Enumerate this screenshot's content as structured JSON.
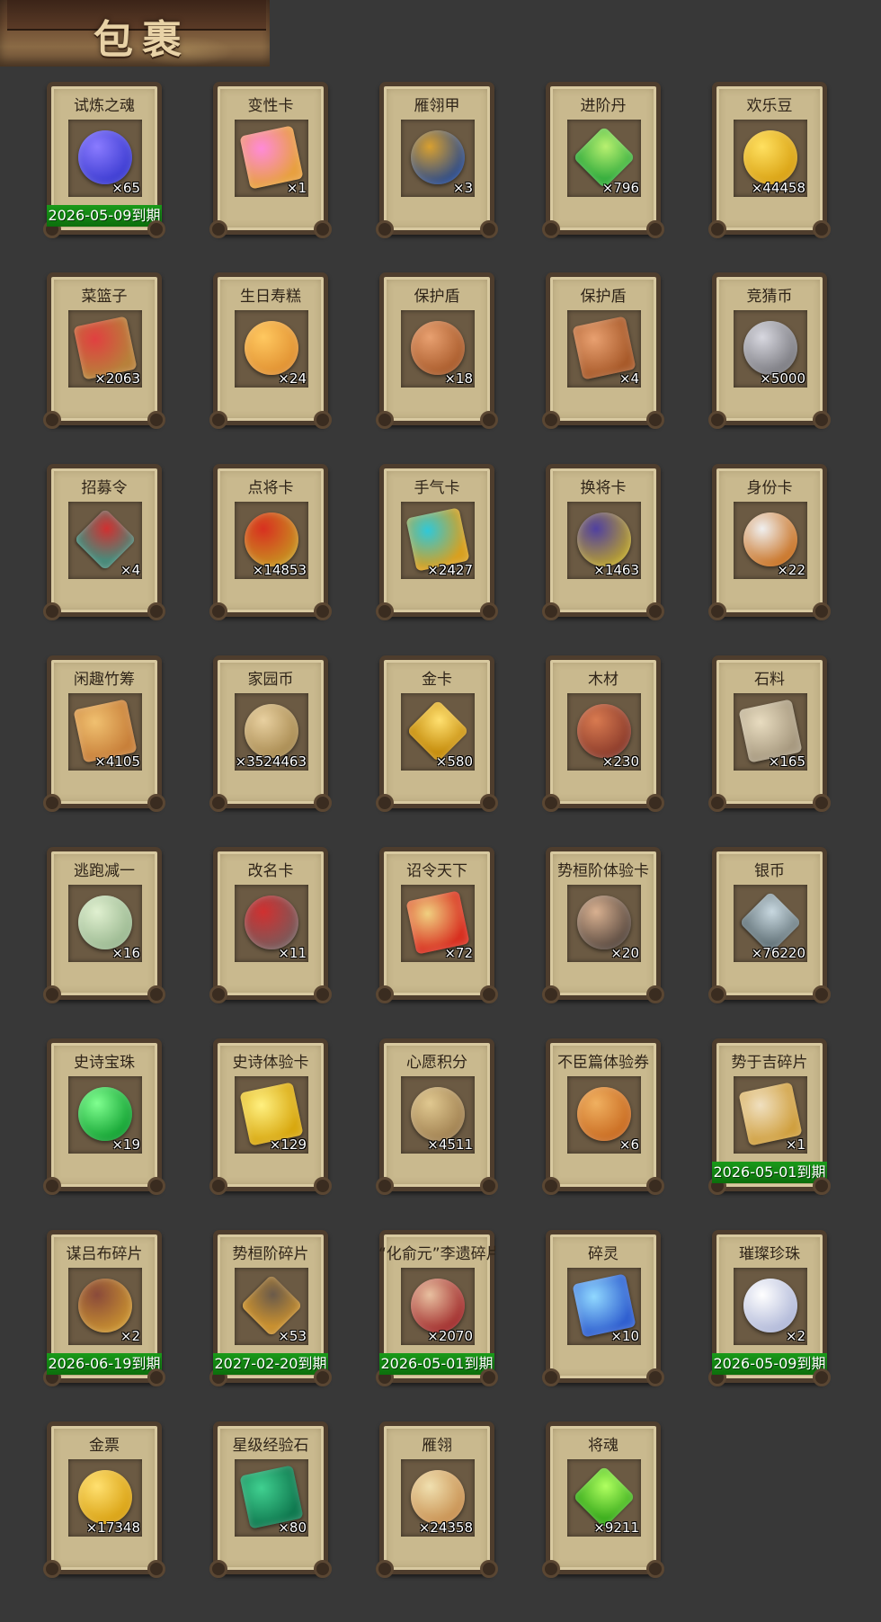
{
  "header": {
    "title": "包裹"
  },
  "colors": {
    "background": "#383838",
    "card": "#c9b98e",
    "card_border": "#4e3d2d",
    "expiry_bar": "#119411"
  },
  "items": [
    {
      "name": "试炼之魂",
      "count": "×65",
      "expiry": "2026-05-09到期",
      "icon": "blue-dragon-orb-icon",
      "c1": "#3a3ad0",
      "c2": "#8a7bff"
    },
    {
      "name": "变性卡",
      "count": "×1",
      "expiry": "",
      "icon": "gender-card-icon",
      "c1": "#e8a040",
      "c2": "#ff8ad8"
    },
    {
      "name": "雁翎甲",
      "count": "×3",
      "expiry": "",
      "icon": "helmet-armor-icon",
      "c1": "#2a4a8a",
      "c2": "#d8a030"
    },
    {
      "name": "进阶丹",
      "count": "×796",
      "expiry": "",
      "icon": "green-pill-icon",
      "c1": "#3ab040",
      "c2": "#b8f070"
    },
    {
      "name": "欢乐豆",
      "count": "×44458",
      "expiry": "",
      "icon": "gold-beans-icon",
      "c1": "#d8a010",
      "c2": "#ffe060"
    },
    {
      "name": "菜篮子",
      "count": "×2063",
      "expiry": "",
      "icon": "basket-icon",
      "c1": "#b8803a",
      "c2": "#e04040"
    },
    {
      "name": "生日寿糕",
      "count": "×24",
      "expiry": "",
      "icon": "birthday-cake-icon",
      "c1": "#e09030",
      "c2": "#ffc860"
    },
    {
      "name": "保护盾",
      "count": "×18",
      "expiry": "",
      "icon": "round-shield-icon",
      "c1": "#a85a2a",
      "c2": "#e8a070"
    },
    {
      "name": "保护盾",
      "count": "×4",
      "expiry": "",
      "icon": "round-shield-icon",
      "c1": "#a85a2a",
      "c2": "#e8a070"
    },
    {
      "name": "竞猜币",
      "count": "×5000",
      "expiry": "",
      "icon": "silver-coin-icon",
      "c1": "#7a7a80",
      "c2": "#d8d8e0"
    },
    {
      "name": "招募令",
      "count": "×4",
      "expiry": "",
      "icon": "recruit-token-icon",
      "c1": "#4a8a7a",
      "c2": "#d03030"
    },
    {
      "name": "点将卡",
      "count": "×14853",
      "expiry": "",
      "icon": "general-card-icon",
      "c1": "#c89020",
      "c2": "#d83020"
    },
    {
      "name": "手气卡",
      "count": "×2427",
      "expiry": "",
      "icon": "luck-card-icon",
      "c1": "#d8a020",
      "c2": "#30c8d8"
    },
    {
      "name": "换将卡",
      "count": "×1463",
      "expiry": "",
      "icon": "swap-general-card-icon",
      "c1": "#b8a030",
      "c2": "#5040a0"
    },
    {
      "name": "身份卡",
      "count": "×22",
      "expiry": "",
      "icon": "identity-mask-card-icon",
      "c1": "#c87020",
      "c2": "#f0f0f0"
    },
    {
      "name": "闲趣竹筹",
      "count": "×4105",
      "expiry": "",
      "icon": "bamboo-tally-icon",
      "c1": "#c8803a",
      "c2": "#f0c070"
    },
    {
      "name": "家园币",
      "count": "×3524463",
      "expiry": "",
      "icon": "home-coin-icon",
      "c1": "#a88a50",
      "c2": "#e8d0a0"
    },
    {
      "name": "金卡",
      "count": "×580",
      "expiry": "",
      "icon": "gold-card-icon",
      "c1": "#c89010",
      "c2": "#ffe070"
    },
    {
      "name": "木材",
      "count": "×230",
      "expiry": "",
      "icon": "timber-icon",
      "c1": "#8a3a2a",
      "c2": "#d87a50"
    },
    {
      "name": "石料",
      "count": "×165",
      "expiry": "",
      "icon": "stone-icon",
      "c1": "#a89a80",
      "c2": "#e8dcc0"
    },
    {
      "name": "逃跑减一",
      "count": "×16",
      "expiry": "",
      "icon": "jade-tag-icon",
      "c1": "#9ab890",
      "c2": "#e0f0d0"
    },
    {
      "name": "改名卡",
      "count": "×11",
      "expiry": "",
      "icon": "rename-tag-icon",
      "c1": "#7a5a5a",
      "c2": "#d03030"
    },
    {
      "name": "诏令天下",
      "count": "×72",
      "expiry": "",
      "icon": "imperial-scroll-icon",
      "c1": "#d83020",
      "c2": "#f0d080"
    },
    {
      "name": "势桓阶体验卡",
      "count": "×20",
      "expiry": "",
      "icon": "hero-portrait-icon",
      "c1": "#5a4a40",
      "c2": "#d8b090"
    },
    {
      "name": "银币",
      "count": "×76220",
      "expiry": "",
      "icon": "silver-coins-icon",
      "c1": "#6a7a80",
      "c2": "#c8d8e0"
    },
    {
      "name": "史诗宝珠",
      "count": "×19",
      "expiry": "",
      "icon": "epic-green-orb-icon",
      "c1": "#10a030",
      "c2": "#80ff90"
    },
    {
      "name": "史诗体验卡",
      "count": "×129",
      "expiry": "",
      "icon": "epic-trial-card-icon",
      "c1": "#d8a810",
      "c2": "#fff080"
    },
    {
      "name": "心愿积分",
      "count": "×4511",
      "expiry": "",
      "icon": "heart-coin-icon",
      "c1": "#a08050",
      "c2": "#e0c890"
    },
    {
      "name": "不臣篇体验券",
      "count": "×6",
      "expiry": "",
      "icon": "trial-ticket-icon",
      "c1": "#c86a20",
      "c2": "#f0b060"
    },
    {
      "name": "势于吉碎片",
      "count": "×1",
      "expiry": "2026-05-01到期",
      "icon": "puzzle-fragment-icon",
      "c1": "#d0a040",
      "c2": "#f0e0c0"
    },
    {
      "name": "谋吕布碎片",
      "count": "×2",
      "expiry": "2026-06-19到期",
      "icon": "puzzle-fragment-icon",
      "c1": "#c89030",
      "c2": "#8a4a3a"
    },
    {
      "name": "势桓阶碎片",
      "count": "×53",
      "expiry": "2027-02-20到期",
      "icon": "puzzle-fragment-icon",
      "c1": "#c89030",
      "c2": "#6a5a4a"
    },
    {
      "name": "“化俞元”李遗碎片",
      "count": "×2070",
      "expiry": "2026-05-01到期",
      "icon": "hero-portrait-icon",
      "c1": "#a02a2a",
      "c2": "#e8c0a0"
    },
    {
      "name": "碎灵",
      "count": "×10",
      "expiry": "",
      "icon": "blue-crystal-icon",
      "c1": "#3060d0",
      "c2": "#90d8ff"
    },
    {
      "name": "璀璨珍珠",
      "count": "×2",
      "expiry": "2026-05-09到期",
      "icon": "pearl-icon",
      "c1": "#b0b8d8",
      "c2": "#ffffff"
    },
    {
      "name": "金票",
      "count": "×17348",
      "expiry": "",
      "icon": "gold-ticket-icon",
      "c1": "#d8a010",
      "c2": "#ffe070"
    },
    {
      "name": "星级经验石",
      "count": "×80",
      "expiry": "",
      "icon": "green-jade-stone-icon",
      "c1": "#107a50",
      "c2": "#40d090"
    },
    {
      "name": "雁翎",
      "count": "×24358",
      "expiry": "",
      "icon": "feather-icon",
      "c1": "#c89050",
      "c2": "#f0e0b0"
    },
    {
      "name": "将魂",
      "count": "×9211",
      "expiry": "",
      "icon": "green-soul-crystal-icon",
      "c1": "#40b020",
      "c2": "#b0ff60"
    }
  ]
}
